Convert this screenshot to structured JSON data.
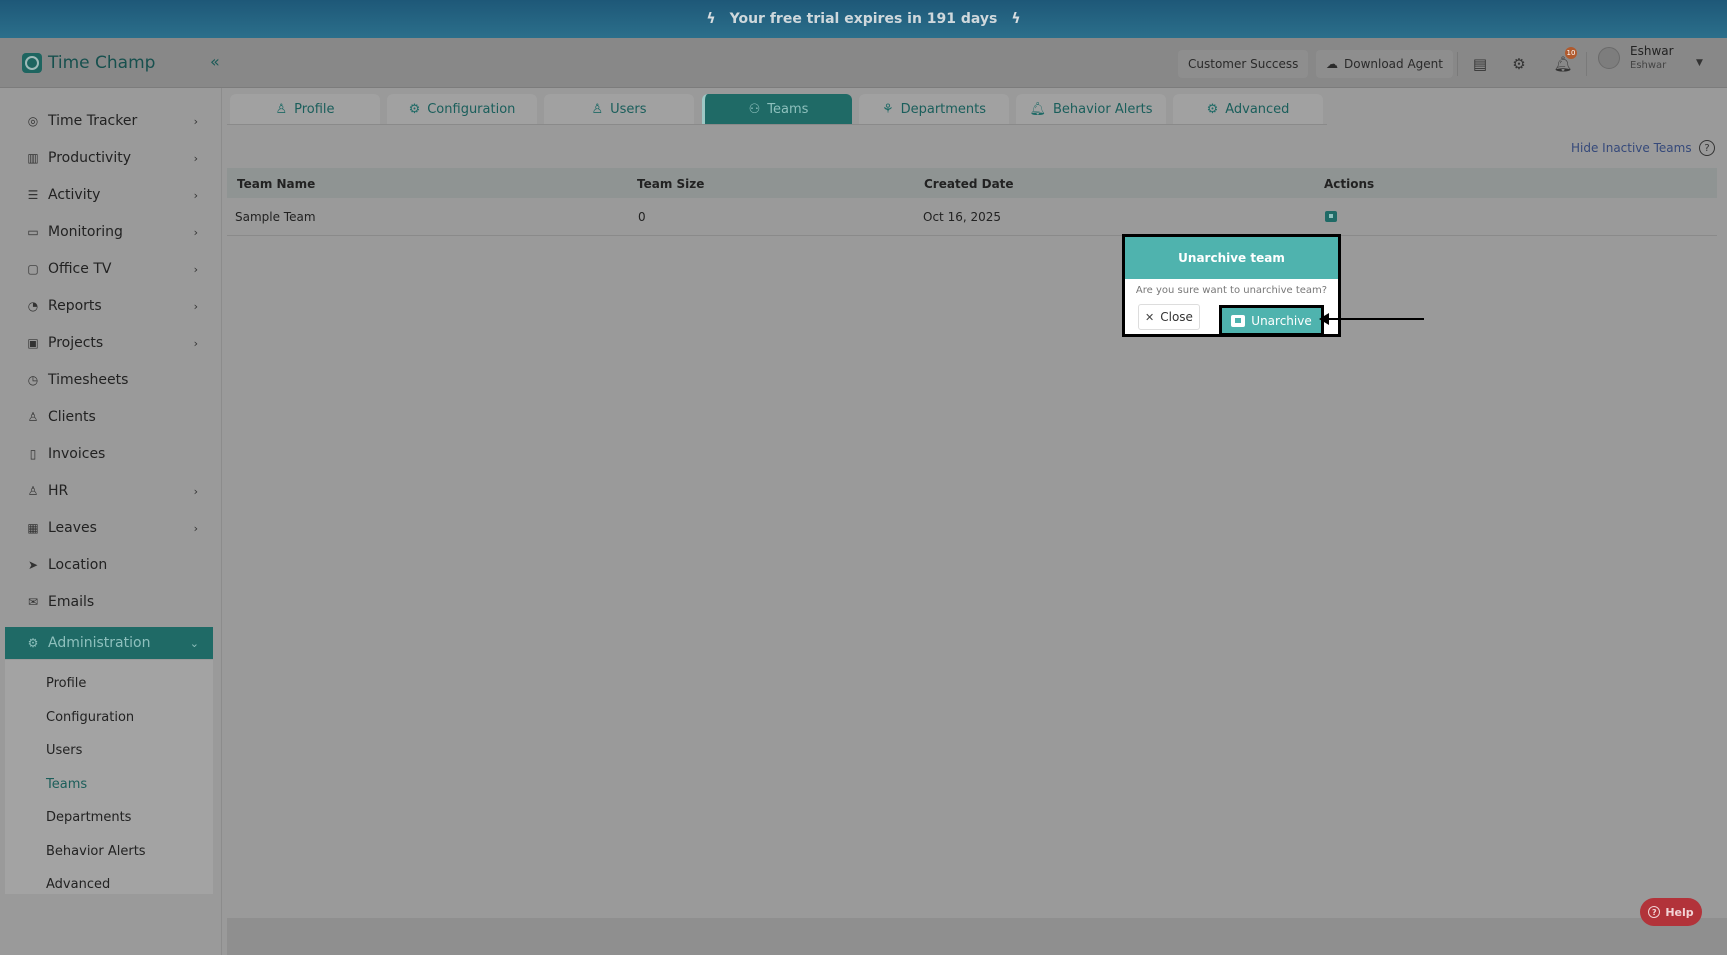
{
  "banner": {
    "text": "Your free trial expires in 191 days"
  },
  "header": {
    "logo": "Time Champ",
    "customer_success": "Customer Success",
    "download_agent": "Download Agent",
    "notifications_count": "10",
    "user_name": "Eshwar",
    "user_subname": "Eshwar"
  },
  "sidebar": {
    "items": [
      {
        "label": "Time Tracker",
        "icon": "clock-icon"
      },
      {
        "label": "Productivity",
        "icon": "chart-icon"
      },
      {
        "label": "Activity",
        "icon": "activity-icon"
      },
      {
        "label": "Monitoring",
        "icon": "monitor-icon"
      },
      {
        "label": "Office TV",
        "icon": "tv-icon"
      },
      {
        "label": "Reports",
        "icon": "pie-chart-icon"
      },
      {
        "label": "Projects",
        "icon": "briefcase-icon"
      },
      {
        "label": "Timesheets",
        "icon": "alarm-icon"
      },
      {
        "label": "Clients",
        "icon": "person-icon"
      },
      {
        "label": "Invoices",
        "icon": "document-icon"
      },
      {
        "label": "HR",
        "icon": "user-icon"
      },
      {
        "label": "Leaves",
        "icon": "calendar-icon"
      },
      {
        "label": "Location",
        "icon": "navigation-icon"
      },
      {
        "label": "Emails",
        "icon": "mail-icon"
      },
      {
        "label": "Administration",
        "icon": "gear-icon"
      }
    ],
    "subitems": [
      {
        "label": "Profile"
      },
      {
        "label": "Configuration"
      },
      {
        "label": "Users"
      },
      {
        "label": "Teams"
      },
      {
        "label": "Departments"
      },
      {
        "label": "Behavior Alerts"
      },
      {
        "label": "Advanced"
      }
    ]
  },
  "tabs": [
    {
      "label": "Profile"
    },
    {
      "label": "Configuration"
    },
    {
      "label": "Users"
    },
    {
      "label": "Teams"
    },
    {
      "label": "Departments"
    },
    {
      "label": "Behavior Alerts"
    },
    {
      "label": "Advanced"
    }
  ],
  "table": {
    "hide_inactive": "Hide Inactive Teams",
    "headers": [
      "Team Name",
      "Team Size",
      "Created Date",
      "Actions"
    ],
    "rows": [
      {
        "name": "Sample Team",
        "size": "0",
        "created": "Oct 16, 2025"
      }
    ]
  },
  "popover": {
    "title": "Unarchive team",
    "message": "Are you sure want to unarchive team?",
    "close_label": "Close",
    "confirm_label": "Unarchive"
  },
  "help": {
    "label": "Help"
  },
  "colors": {
    "accent": "#4fb3ae",
    "accent_dark": "#1f6a66",
    "help": "#b2333a"
  }
}
